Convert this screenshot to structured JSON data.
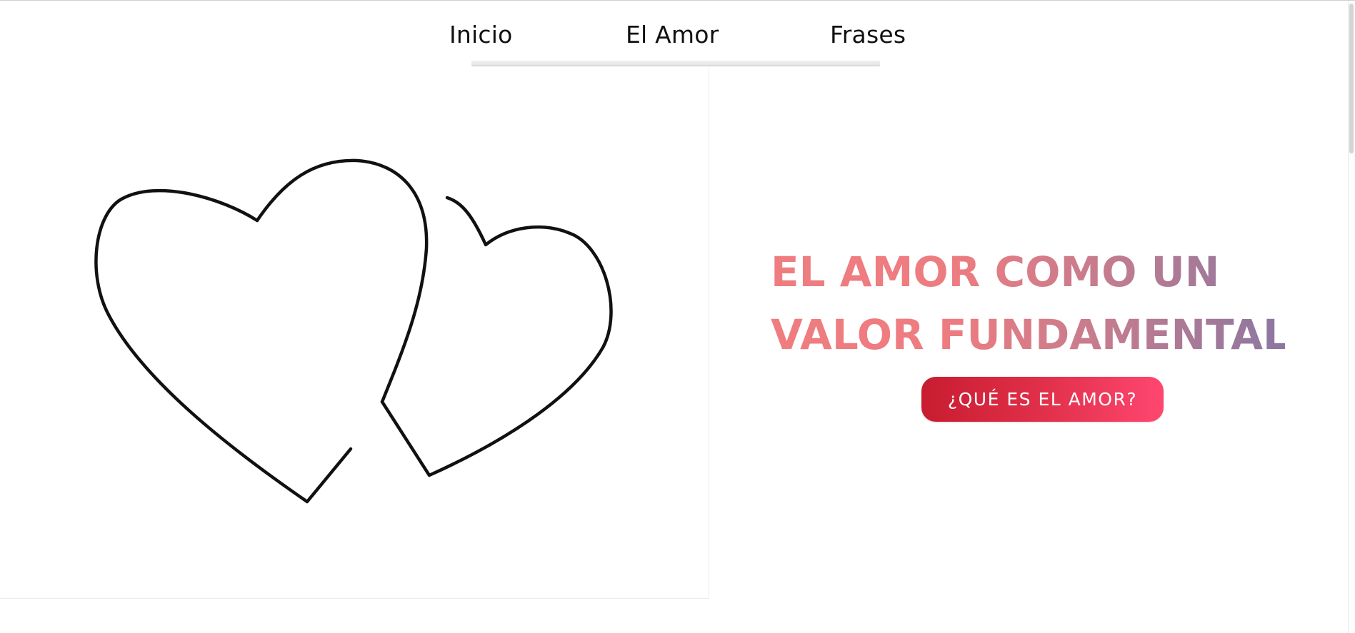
{
  "nav": {
    "items": [
      {
        "label": "Inicio"
      },
      {
        "label": "El Amor"
      },
      {
        "label": "Frases"
      }
    ]
  },
  "hero": {
    "image_icon": "two-hearts-outline",
    "title_line1": "EL AMOR COMO UN",
    "title_line2": "VALOR FUNDAMENTAL",
    "button_label": "¿QUÉ ES EL AMOR?"
  },
  "colors": {
    "title_gradient_start": "#ef7d80",
    "title_gradient_end": "#8b77a1",
    "button_gradient_start": "#c81c30",
    "button_gradient_end": "#ff4670",
    "heart_stroke": "#111111"
  }
}
